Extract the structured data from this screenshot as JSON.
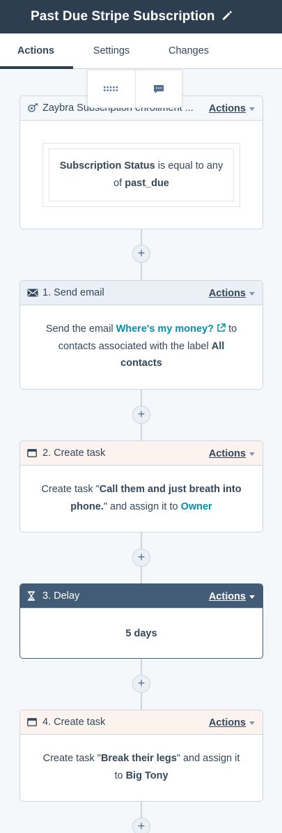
{
  "header": {
    "title": "Past Due Stripe Subscription"
  },
  "tabs": [
    {
      "label": "Actions",
      "active": true
    },
    {
      "label": "Settings",
      "active": false
    },
    {
      "label": "Changes",
      "active": false
    }
  ],
  "toolbar": {
    "icons": [
      "grid-dots-icon",
      "comment-icon"
    ]
  },
  "cards": {
    "trigger": {
      "title": "Zaybra Subscription enrollment ...",
      "actions_label": "Actions",
      "filter": {
        "property": "Subscription Status",
        "operator": "is equal to any of",
        "value": "past_due"
      }
    },
    "step1": {
      "title": "1. Send email",
      "actions_label": "Actions",
      "text_before": "Send the email",
      "email_link": "Where's my money?",
      "text_middle": "to contacts associated with the label",
      "label": "All contacts"
    },
    "step2": {
      "title": "2. Create task",
      "actions_label": "Actions",
      "text_before": "Create task \"",
      "task_name": "Call them and just breath into phone.",
      "text_after": "\" and assign it to",
      "assignee": "Owner"
    },
    "step3": {
      "title": "3. Delay",
      "actions_label": "Actions",
      "duration": "5 days"
    },
    "step4": {
      "title": "4. Create task",
      "actions_label": "Actions",
      "text_before": "Create task \"",
      "task_name": "Break their legs",
      "text_after": "\" and assign it to",
      "assignee": "Big Tony"
    }
  },
  "add_button_glyph": "+",
  "colors": {
    "header_bg": "#2d3e50",
    "link": "#0091ae",
    "delay_header": "#425b76",
    "task_header": "#fdf3ee",
    "email_header": "#eaf0f6"
  }
}
